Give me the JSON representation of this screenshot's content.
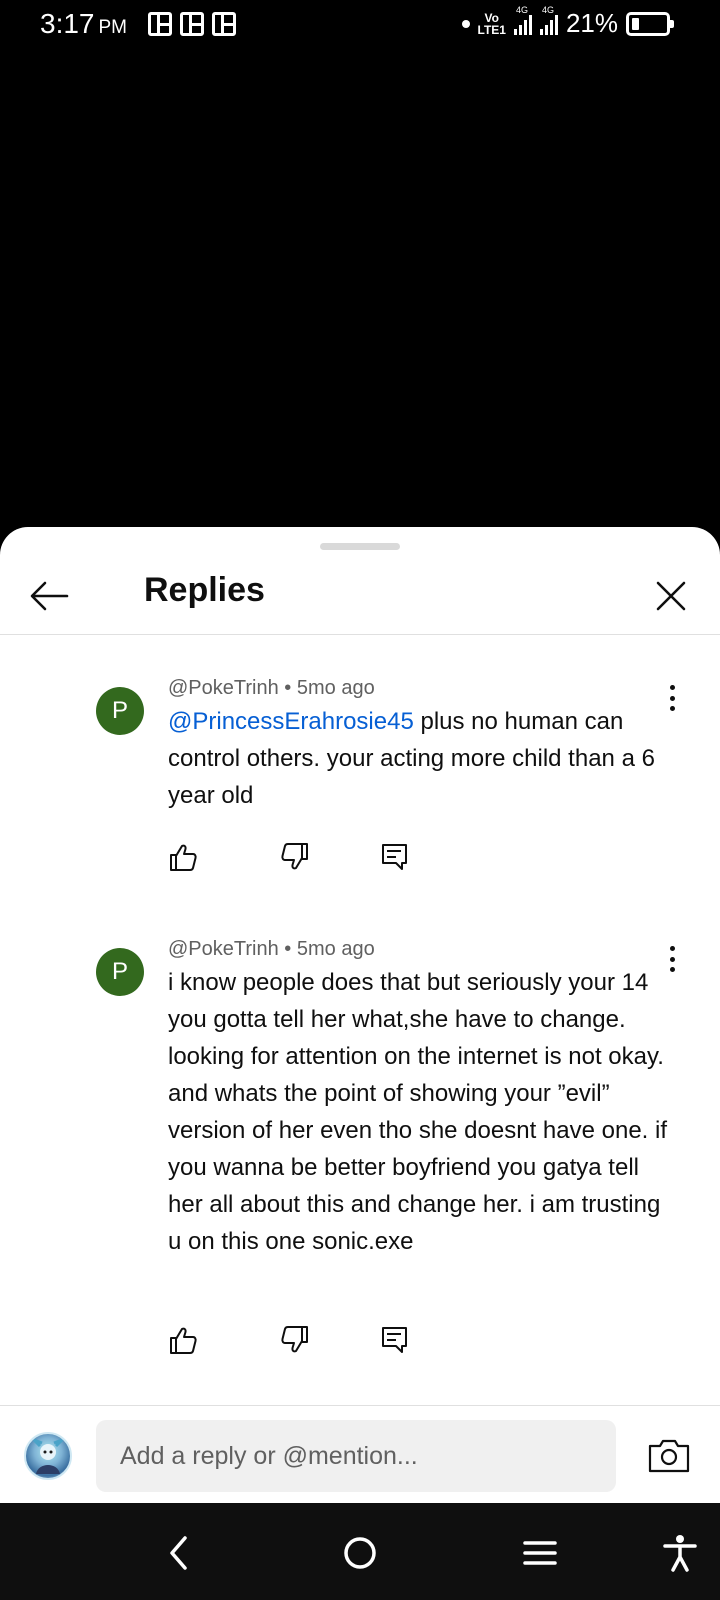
{
  "status_bar": {
    "time": "3:17",
    "ampm": "PM",
    "volte": "Vo",
    "lte": "LTE1",
    "net1": "4G",
    "net2": "4G",
    "battery": "21%",
    "battery_level": 0.21
  },
  "sheet": {
    "title": "Replies"
  },
  "comments": [
    {
      "author": "@PokeTrinh",
      "age": "5mo ago",
      "avatar_letter": "P",
      "mention": "@PrincessErahrosie45",
      "text": " plus no human can control others. your acting more child than a 6 year old"
    },
    {
      "author": "@PokeTrinh",
      "age": "5mo ago",
      "avatar_letter": "P",
      "text": "i know people does that but seriously your 14 you gotta tell her what,she have to change. looking for attention on the internet is not okay. and whats the point of showing your ”evil” version of her even tho she doesnt have one. if you wanna be better boyfriend you gatya tell her all about this and change her. i am trusting u on this one sonic.exe"
    }
  ],
  "meta_separator": "•",
  "composer": {
    "placeholder": "Add a reply or @mention..."
  },
  "colors": {
    "avatar_bg": "#33691e",
    "mention": "#065fd4",
    "meta": "#606060"
  }
}
